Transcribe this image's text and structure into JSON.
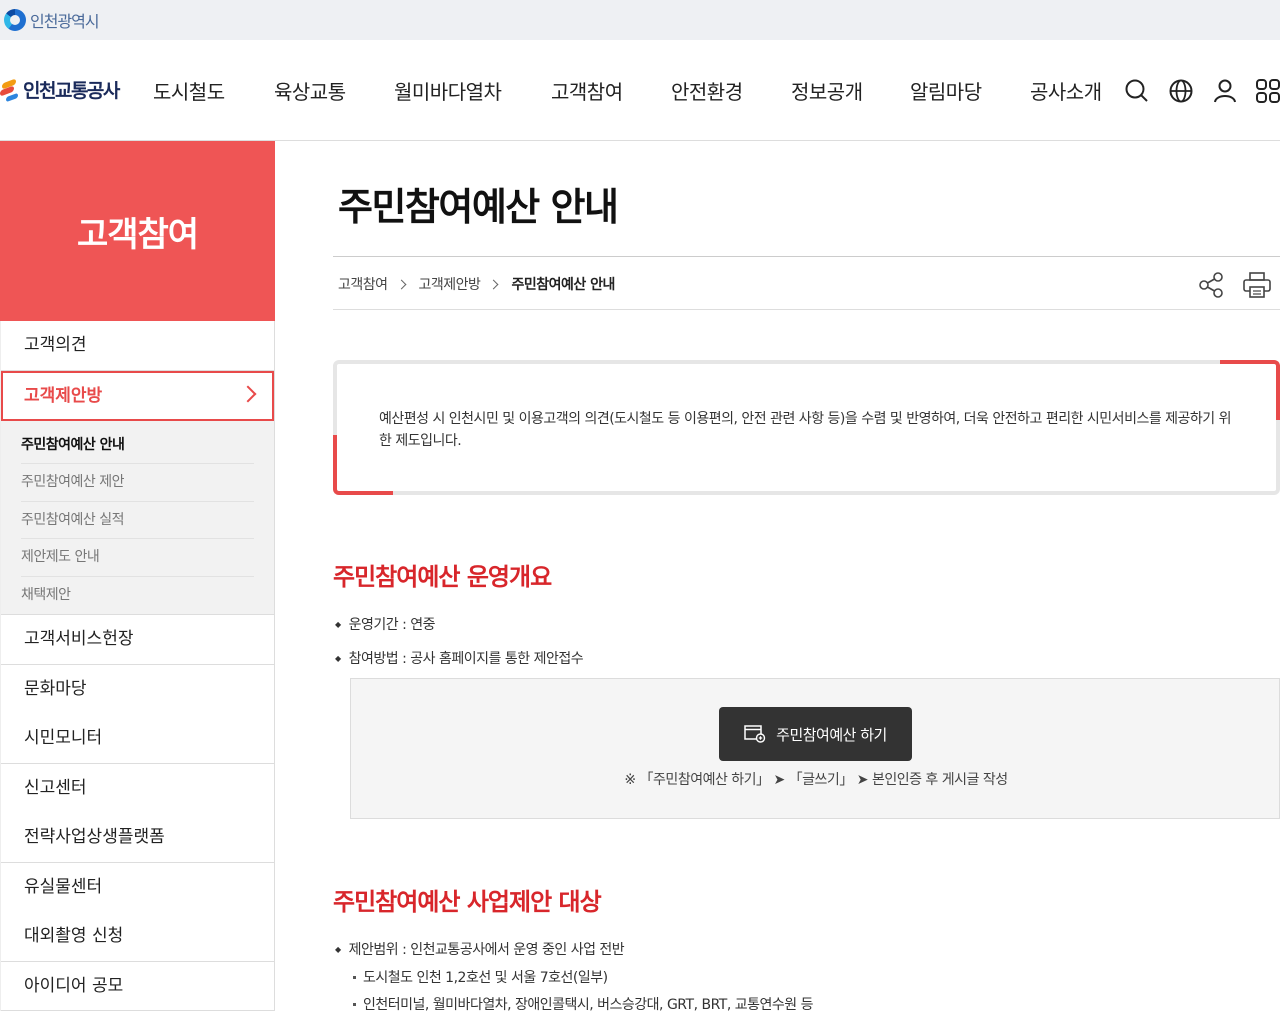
{
  "gov": {
    "name": "인천광역시"
  },
  "brand": {
    "name": "인천교통공사"
  },
  "gnb": [
    "도시철도",
    "육상교통",
    "월미바다열차",
    "고객참여",
    "안전환경",
    "정보공개",
    "알림마당",
    "공사소개"
  ],
  "utils": {
    "icons": [
      "search-icon",
      "globe-icon",
      "user-icon",
      "menu-grid-icon"
    ]
  },
  "lnb": {
    "title": "고객참여",
    "items": {
      "i0": "고객의견",
      "i1": "고객제안방",
      "i2": "고객서비스헌장",
      "i3": "문화마당",
      "i4": "시민모니터",
      "i5": "신고센터",
      "i6": "전략사업상생플랫폼",
      "i7": "유실물센터",
      "i8": "대외촬영 신청",
      "i9": "아이디어 공모"
    },
    "sub": [
      "주민참여예산 안내",
      "주민참여예산 제안",
      "주민참여예산 실적",
      "제안제도 안내",
      "채택제안"
    ]
  },
  "content": {
    "title": "주민참여예산 안내",
    "breadcrumb": [
      "고객참여",
      "고객제안방",
      "주민참여예산 안내"
    ],
    "intro": "예산편성 시 인천시민 및 이용고객의 의견(도시철도 등 이용편의, 안전 관련 사항 등)을 수렴 및 반영하여, 더욱 안전하고 편리한 시민서비스를 제공하기 위한 제도입니다.",
    "section1": {
      "title": "주민참여예산 운영개요",
      "b1": "운영기간 : 연중",
      "b2": "참여방법 : 공사 홈페이지를 통한 제안접수",
      "button": "주민참여예산 하기",
      "note": "※ 「주민참여예산 하기」 ➤ 「글쓰기」 ➤ 본인인증 후 게시글 작성"
    },
    "section2": {
      "title": "주민참여예산 사업제안 대상",
      "b1": "제안범위 : 인천교통공사에서 운영 중인 사업 전반",
      "s1": "도시철도 인천 1,2호선 및 서울 7호선(일부)",
      "s2": "인천터미널, 월미바다열차, 장애인콜택시, 버스승강대, GRT, BRT, 교통연수원 등"
    }
  },
  "colors": {
    "accent": "#ef5555",
    "section_title": "#d8262b",
    "button": "#333333"
  }
}
